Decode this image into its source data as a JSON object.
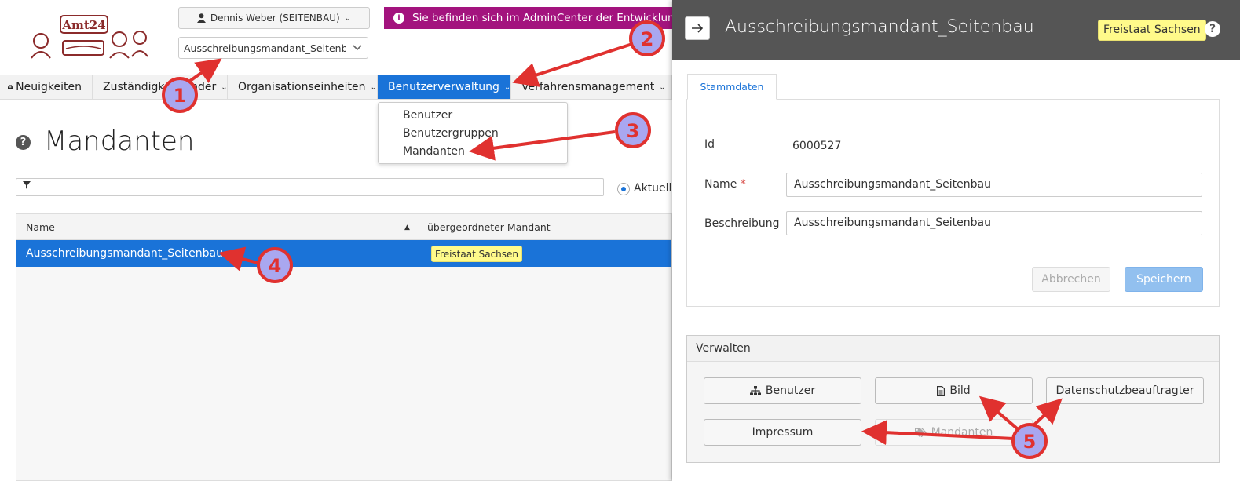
{
  "header": {
    "logo_text": "Amt24",
    "user_button": "Dennis Weber (SEITENBAU)",
    "tenant_select": "Ausschreibungsmandant_Seitenbau",
    "env_banner": "Sie befinden sich im AdminCenter der Entwicklungs"
  },
  "nav": {
    "items": [
      {
        "label": "Neuigkeiten"
      },
      {
        "label": "Zuständigkeitsfinder"
      },
      {
        "label": "Organisationseinheiten"
      },
      {
        "label": "Benutzerverwaltung"
      },
      {
        "label": "Verfahrensmanagement"
      }
    ],
    "dropdown": [
      "Benutzer",
      "Benutzergruppen",
      "Mandanten"
    ]
  },
  "page": {
    "title": "Mandanten",
    "filter_placeholder": "",
    "radio_label": "Aktuelle",
    "table": {
      "columns": [
        "Name",
        "übergeordneter Mandant"
      ],
      "rows": [
        {
          "name": "Ausschreibungsmandant_Seitenbau",
          "parent": "Freistaat Sachsen"
        }
      ]
    }
  },
  "panel": {
    "title": "Ausschreibungsmandant_Seitenbau",
    "tag": "Freistaat Sachsen",
    "tab": "Stammdaten",
    "fields": {
      "id_label": "Id",
      "id_value": "6000527",
      "name_label": "Name",
      "name_required": "*",
      "name_value": "Ausschreibungsmandant_Seitenbau",
      "desc_label": "Beschreibung",
      "desc_value": "Ausschreibungsmandant_Seitenbau"
    },
    "cancel": "Abbrechen",
    "save": "Speichern",
    "manage": {
      "title": "Verwalten",
      "buttons": [
        "Benutzer",
        "Bild",
        "Datenschutzbeauftragter",
        "Impressum",
        "Mandanten"
      ]
    }
  },
  "annotations": [
    "1",
    "2",
    "3",
    "4",
    "5"
  ],
  "colors": {
    "accent": "#1a73d8",
    "banner": "#a3137e",
    "panel_header": "#555555",
    "tag": "#fffa8a",
    "annotation": "#e0312f",
    "annotation_fill": "#a9a7f0"
  }
}
